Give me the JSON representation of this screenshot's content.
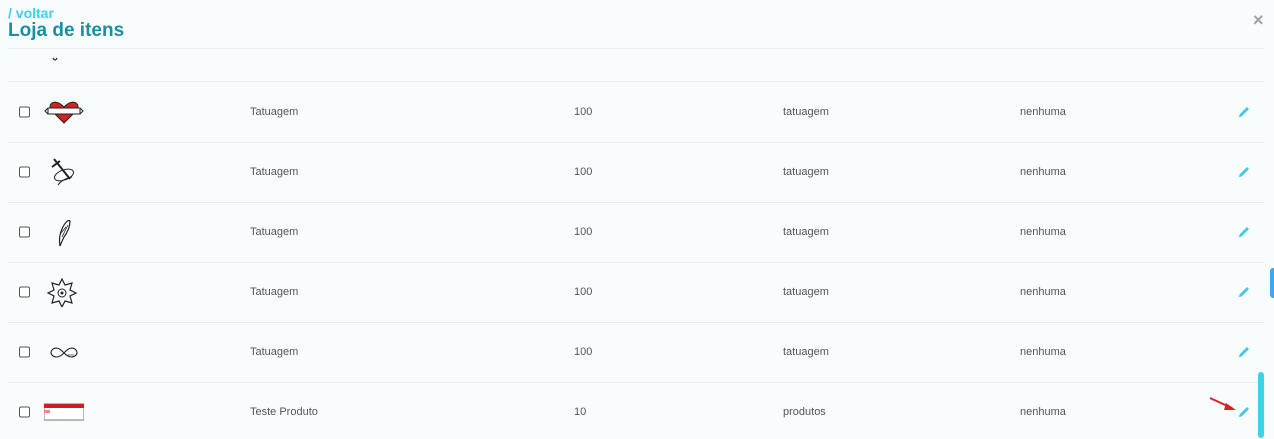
{
  "header": {
    "back_label": "/ voltar",
    "title": "Loja de itens"
  },
  "close_glyph": "×",
  "rows": [
    {
      "icon": "heart-tattoo-icon",
      "name": "Tatuagem",
      "price": "100",
      "category": "tatuagem",
      "requirement": "nenhuma"
    },
    {
      "icon": "dagger-tattoo-icon",
      "name": "Tatuagem",
      "price": "100",
      "category": "tatuagem",
      "requirement": "nenhuma"
    },
    {
      "icon": "feather-tattoo-icon",
      "name": "Tatuagem",
      "price": "100",
      "category": "tatuagem",
      "requirement": "nenhuma"
    },
    {
      "icon": "mandala-star-tattoo-icon",
      "name": "Tatuagem",
      "price": "100",
      "category": "tatuagem",
      "requirement": "nenhuma"
    },
    {
      "icon": "infinity-tattoo-icon",
      "name": "Tatuagem",
      "price": "100",
      "category": "tatuagem",
      "requirement": "nenhuma"
    },
    {
      "icon": "product-banner-icon",
      "name": "Teste Produto",
      "price": "10",
      "category": "produtos",
      "requirement": "nenhuma"
    }
  ],
  "colors": {
    "accent": "#3fd0ea",
    "title": "#1a8fa3",
    "edit_icon": "#3fc8ea",
    "arrow": "#e02020"
  }
}
